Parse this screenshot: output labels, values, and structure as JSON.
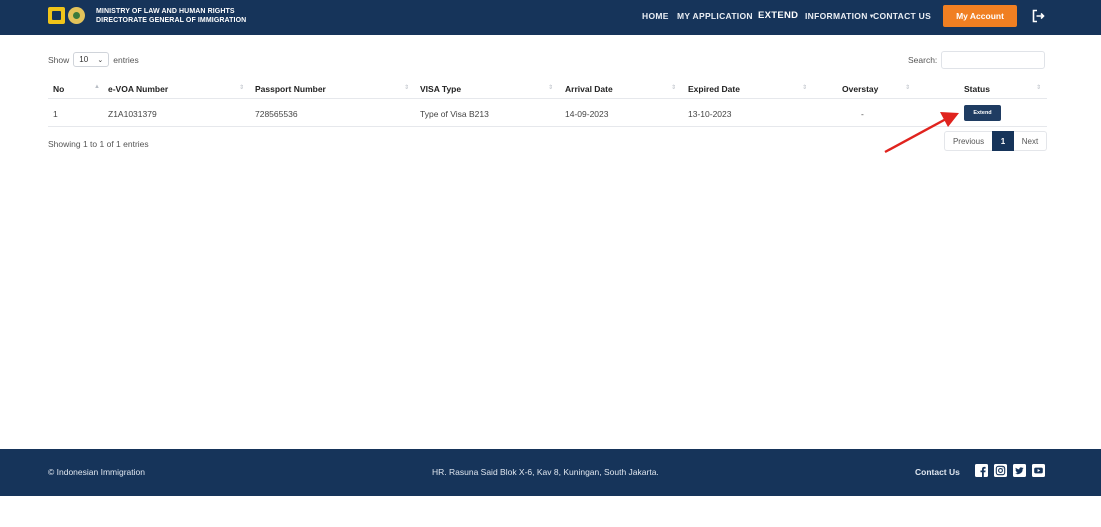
{
  "header": {
    "brand_line1": "MINISTRY OF LAW AND HUMAN RIGHTS",
    "brand_line2": "DIRECTORATE GENERAL OF IMMIGRATION",
    "nav": {
      "home": "HOME",
      "my_application": "MY APPLICATION",
      "extend": "EXTEND",
      "information": "INFORMATION",
      "contact": "CONTACT US"
    },
    "account_button": "My Account"
  },
  "controls": {
    "show_label": "Show",
    "entries_value": "10",
    "entries_label": "entries",
    "search_label": "Search:",
    "search_value": ""
  },
  "table": {
    "columns": [
      "No",
      "e-VOA Number",
      "Passport Number",
      "VISA Type",
      "Arrival Date",
      "Expired Date",
      "Overstay",
      "Status"
    ],
    "rows": [
      {
        "no": "1",
        "evoa": "Z1A1031379",
        "passport": "728565536",
        "visa_type": "Type of Visa B213",
        "arrival": "14-09-2023",
        "expired": "13-10-2023",
        "overstay": "-",
        "status_button": "Extend"
      }
    ]
  },
  "info_text": "Showing 1 to 1 of 1 entries",
  "pagination": {
    "previous": "Previous",
    "current": "1",
    "next": "Next"
  },
  "footer": {
    "copyright": "© Indonesian Immigration",
    "address": "HR. Rasuna Said Blok X-6, Kav 8, Kuningan, South Jakarta.",
    "contact_label": "Contact Us",
    "social_icons": [
      "facebook-icon",
      "instagram-icon",
      "twitter-icon",
      "youtube-icon"
    ]
  },
  "colors": {
    "navy": "#16345a",
    "accent_orange": "#f07f22",
    "annotation_arrow": "#e0231e"
  }
}
